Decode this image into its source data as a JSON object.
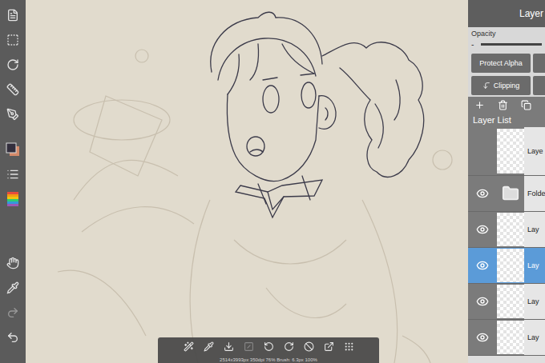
{
  "panel": {
    "title": "Layer",
    "opacity_label": "Opacity",
    "opacity_minus": "-",
    "opacity_level": 1.0,
    "protect_alpha": "Protect Alpha",
    "clipping": "Clipping",
    "list_title": "Layer List"
  },
  "layers": [
    {
      "name": "Laye",
      "kind": "layer",
      "visible": false,
      "selected": false
    },
    {
      "name": "Folde",
      "kind": "folder",
      "visible": true,
      "selected": false
    },
    {
      "name": "Lay",
      "kind": "layer",
      "visible": true,
      "selected": false
    },
    {
      "name": "Lay",
      "kind": "layer",
      "visible": true,
      "selected": true
    },
    {
      "name": "Lay",
      "kind": "layer",
      "visible": true,
      "selected": false
    },
    {
      "name": "Lay",
      "kind": "layer",
      "visible": true,
      "selected": false
    }
  ],
  "status_bar": "2514x3993px 350dpi 76% Brush: 6.3px 100%"
}
